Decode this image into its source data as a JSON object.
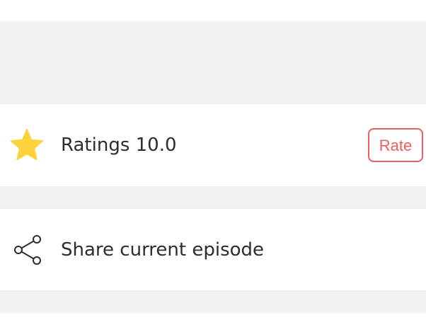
{
  "ratings_row": {
    "label": "Ratings 10.0",
    "icon": "star-icon",
    "rate_button_label": "Rate"
  },
  "share_row": {
    "label": "Share current episode",
    "icon": "share-icon"
  },
  "colors": {
    "background": "#ffffff",
    "separator": "#eff2f3",
    "star": "#fdd23a",
    "accent": "#ef5e5e",
    "text": "#2b2d31"
  }
}
